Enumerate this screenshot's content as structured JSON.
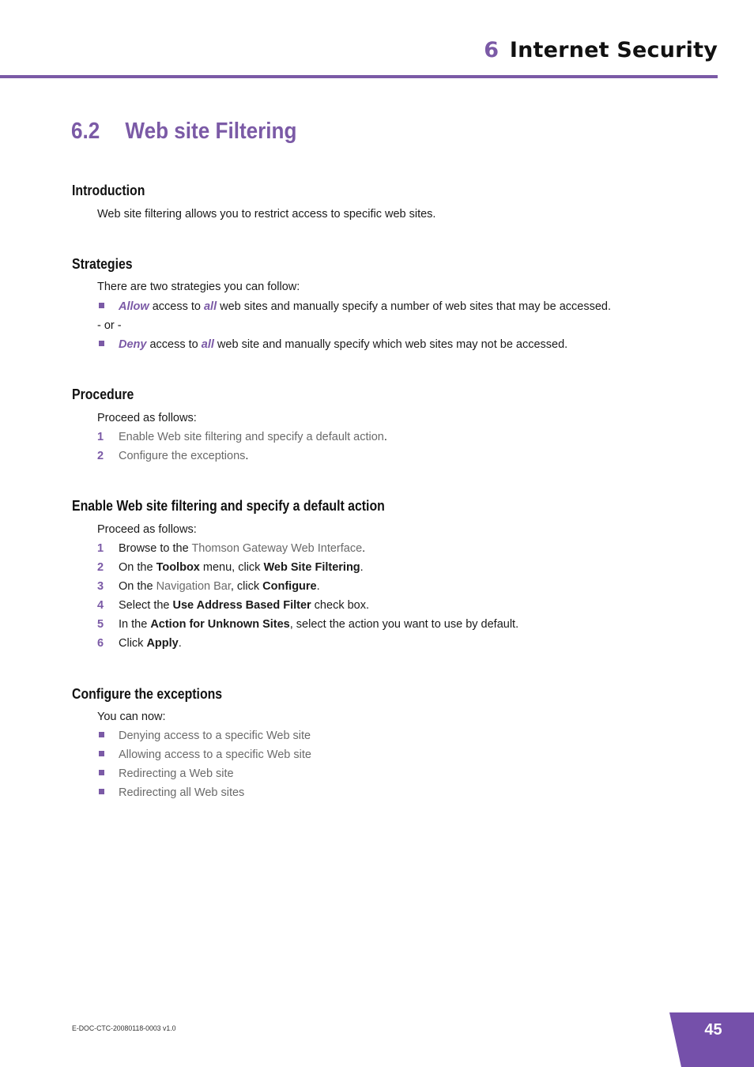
{
  "header": {
    "chapter_number": "6",
    "chapter_title": "Internet Security"
  },
  "section": {
    "number": "6.2",
    "title": "Web site Filtering"
  },
  "introduction": {
    "heading": "Introduction",
    "text": "Web site filtering allows you to restrict access to specific web sites."
  },
  "strategies": {
    "heading": "Strategies",
    "intro": "There are two strategies you can follow:",
    "item1": {
      "em1": "Allow",
      "t1": " access to ",
      "em2": "all",
      "t2": " web sites and manually specify a number of web sites that may be accessed."
    },
    "separator": "- or -",
    "item2": {
      "em1": "Deny",
      "t1": " access to ",
      "em2": "all",
      "t2": " web site and manually specify which web sites may not be accessed."
    }
  },
  "procedure": {
    "heading": "Procedure",
    "intro": "Proceed as follows:",
    "steps": [
      {
        "num": "1",
        "link": "Enable Web site filtering and specify a default action",
        "end": "."
      },
      {
        "num": "2",
        "link": "Configure the exceptions",
        "end": "."
      }
    ]
  },
  "enable": {
    "heading": "Enable Web site filtering and specify a default action",
    "intro": "Proceed as follows:",
    "steps": [
      {
        "num": "1",
        "a": "Browse to the ",
        "link": "Thomson Gateway Web Interface",
        "b": "."
      },
      {
        "num": "2",
        "a": "On the ",
        "bold1": "Toolbox",
        "b": " menu, click ",
        "bold2": "Web Site Filtering",
        "c": "."
      },
      {
        "num": "3",
        "a": "On the ",
        "link": "Navigation Bar",
        "b": ", click ",
        "bold1": "Configure",
        "c": "."
      },
      {
        "num": "4",
        "a": "Select the ",
        "bold1": "Use Address Based Filter",
        "b": " check box."
      },
      {
        "num": "5",
        "a": "In the ",
        "bold1": "Action for Unknown Sites",
        "b": ", select the action you want to use by default."
      },
      {
        "num": "6",
        "a": "Click ",
        "bold1": "Apply",
        "b": "."
      }
    ]
  },
  "exceptions": {
    "heading": "Configure the exceptions",
    "intro": "You can now:",
    "items": [
      "Denying access to a specific Web site",
      "Allowing access to a specific Web site",
      "Redirecting a Web site",
      "Redirecting all Web sites"
    ]
  },
  "footer": {
    "doc_id": "E-DOC-CTC-20080118-0003 v1.0",
    "page_number": "45"
  },
  "colors": {
    "accent": "#7b5aa6",
    "page_tab": "#7550aa",
    "link_text": "#6a6a6a"
  }
}
